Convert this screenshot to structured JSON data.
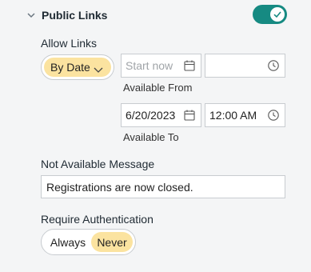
{
  "header": {
    "title": "Public Links",
    "toggle_on": true
  },
  "allow_links": {
    "label": "Allow Links",
    "mode": "By Date",
    "from": {
      "date_placeholder": "Start now",
      "date_value": "",
      "time_value": "",
      "caption": "Available From"
    },
    "to": {
      "date_value": "6/20/2023",
      "time_value": "12:00 AM",
      "caption": "Available To"
    }
  },
  "not_available": {
    "label": "Not Available Message",
    "value": "Registrations are now closed."
  },
  "require_auth": {
    "label": "Require Authentication",
    "options": [
      "Always",
      "Never"
    ],
    "selected": "Never"
  },
  "colors": {
    "accent": "#168a82",
    "highlight": "#fbe3a0",
    "border": "#c8ccd0",
    "background": "#f4f5f6"
  },
  "icons": [
    "chevron-down-icon",
    "check-icon",
    "calendar-icon",
    "clock-icon"
  ]
}
